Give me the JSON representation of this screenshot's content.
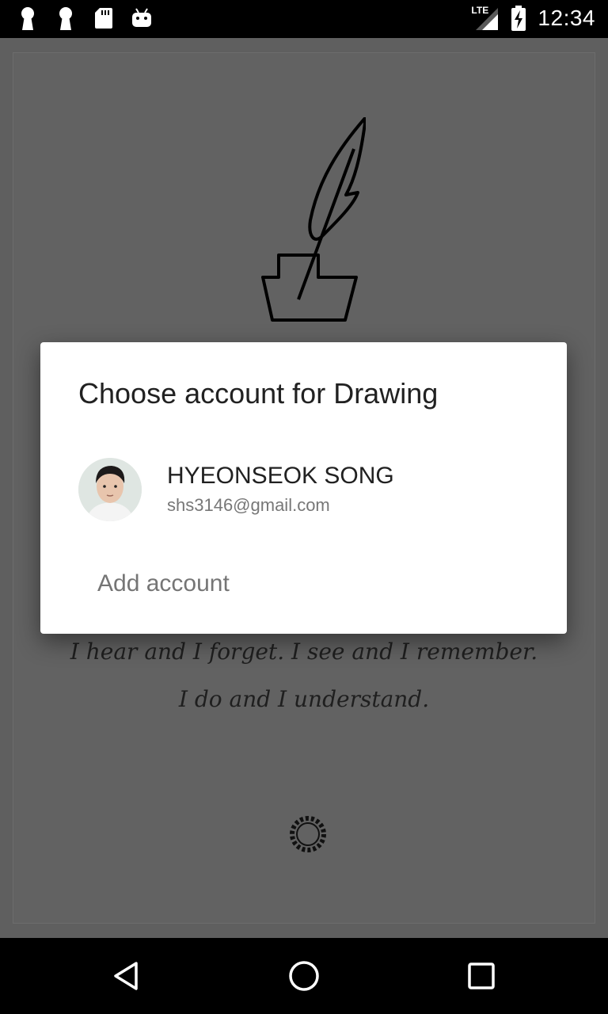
{
  "status_bar": {
    "time": "12:34",
    "network_label": "LTE",
    "icons": [
      "keyhole-icon",
      "keyhole-icon",
      "sd-card-icon",
      "android-icon",
      "signal-icon",
      "battery-charging-icon"
    ]
  },
  "background": {
    "logo_icon": "quill-inkwell-icon",
    "quote_line_1": "I hear and I forget. I see and I remember.",
    "quote_line_2": "I do and I understand.",
    "loader_icon": "loading-spinner-icon"
  },
  "dialog": {
    "title": "Choose account for Drawing",
    "accounts": [
      {
        "name": "HYEONSEOK SONG",
        "email": "shs3146@gmail.com"
      }
    ],
    "add_account_label": "Add account"
  },
  "nav_bar": {
    "icons": [
      "back-icon",
      "home-icon",
      "recents-icon"
    ]
  },
  "colors": {
    "scrim": "#5f5f5f",
    "dialog_bg": "#ffffff",
    "title_text": "#212121",
    "secondary_text": "#777777"
  }
}
